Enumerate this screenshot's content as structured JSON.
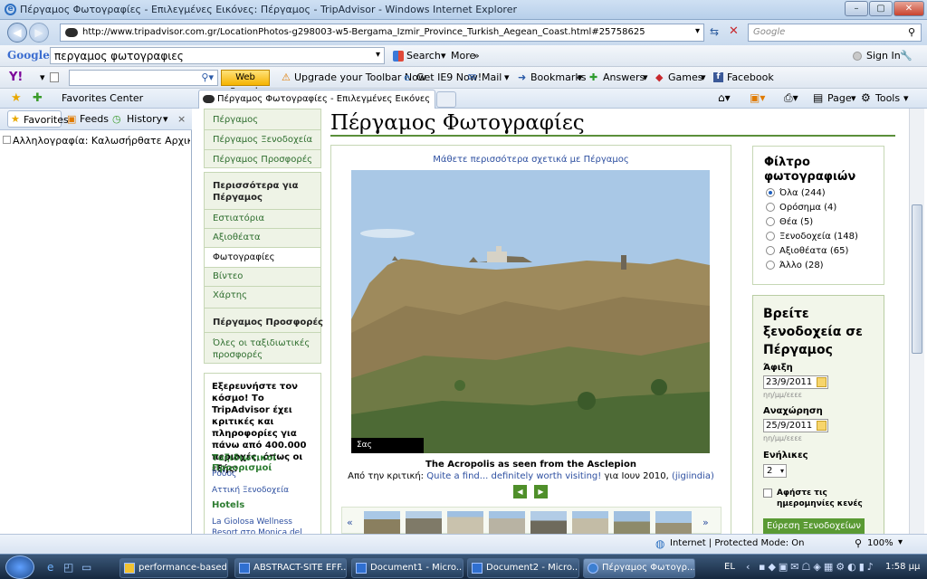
{
  "window": {
    "title": "Πέργαμος Φωτογραφίες - Επιλεγμένες Εικόνες: Πέργαμος - TripAdvisor - Windows Internet Explorer"
  },
  "address_bar": {
    "url": "http://www.tripadvisor.com.gr/LocationPhotos-g298003-w5-Bergama_Izmir_Province_Turkish_Aegean_Coast.html#25758625",
    "search_placeholder": "Google"
  },
  "google_toolbar": {
    "logo": "Google",
    "query": "περγαμος φωτογραφιες",
    "search_label": "Search",
    "more_label": "More",
    "signin_label": "Sign In"
  },
  "yahoo_toolbar": {
    "logo": "Y!",
    "web_search_label": "Web Search",
    "upgrade_label": "Upgrade your Toolbar Now",
    "ie9_label": "Get IE9 Now!",
    "mail_label": "Mail",
    "bookmarks_label": "Bookmarks",
    "answers_label": "Answers",
    "games_label": "Games",
    "facebook_label": "Facebook"
  },
  "favorites_bar": {
    "favorites_center_label": "Favorites Center",
    "tab_label": "Πέργαμος Φωτογραφίες - Επιλεγμένες Εικόνες: ...",
    "page_label": "Page",
    "tools_label": "Tools"
  },
  "favorites_panel": {
    "tabs": [
      "Favorites",
      "Feeds",
      "History"
    ],
    "close_label": "×",
    "items": [
      "Αλληλογραφία: Καλωσήρθατε Αρχική ..."
    ]
  },
  "left_nav": {
    "group1": [
      "Πέργαμος",
      "Πέργαμος Ξενοδοχεία",
      "Πέργαμος Προσφορές"
    ],
    "more_heading": "Περισσότερα για Πέργαμος",
    "group2": [
      "Εστιατόρια",
      "Αξιοθέατα",
      "Φωτογραφίες",
      "Βίντεο",
      "Χάρτης"
    ],
    "offers_heading": "Πέργαμος Προσφορές",
    "all_offers": "Όλες οι ταξιδιωτικές προσφορές",
    "explore_text": "Εξερευνήστε τον κόσμο! Το TripAdvisor έχει κριτικές και πληροφορίες για πάνω από 400.000 περιοχές, όπως οι εξής:",
    "explore_heading": "Ταξιδιωτικοί Προορισμοί",
    "explore_links": [
      "Ρόδος",
      "Αττική Ξενοδοχεία"
    ],
    "hotels_heading": "Hotels",
    "hotels_link": "La Giolosa Wellness Resort στο Monica del Garda"
  },
  "main": {
    "title": "Πέργαμος Φωτογραφίες",
    "learn_more": "Μάθετε περισσότερα σχετικά με Πέργαμος",
    "thanks_badge": "Σας ευχαριστούμε",
    "caption": "The Acropolis as seen from the Asclepion",
    "review_prefix": "Από την κριτική:",
    "review_link": "Quite a find... definitely worth visiting!",
    "review_date": "για Ιουν 2010,",
    "review_author": "(jigiindia)",
    "prev_label": "◀",
    "next_label": "▶",
    "thumb_prev": "«",
    "thumb_next": "»"
  },
  "filter": {
    "heading": "Φίλτρο φωτογραφιών",
    "options": [
      {
        "label": "Όλα (244)",
        "selected": true
      },
      {
        "label": "Ορόσημα (4)",
        "selected": false
      },
      {
        "label": "Θέα (5)",
        "selected": false
      },
      {
        "label": "Ξενοδοχεία (148)",
        "selected": false
      },
      {
        "label": "Αξιοθέατα (65)",
        "selected": false
      },
      {
        "label": "Άλλο (28)",
        "selected": false
      }
    ]
  },
  "hotel_search": {
    "heading": "Βρείτε ξενοδοχεία σε Πέργαμος",
    "checkin_label": "Άφιξη",
    "checkin_value": "23/9/2011",
    "checkout_label": "Αναχώρηση",
    "checkout_value": "25/9/2011",
    "date_hint": "ηη/μμ/εεεε",
    "adults_label": "Ενήλικες",
    "adults_value": "2",
    "leave_dates_label": "Αφήστε τις ημερομηνίες κενές",
    "submit_label": "Εύρεση Ξενοδοχείων"
  },
  "status_bar": {
    "zone": "Internet | Protected Mode: On",
    "zoom": "100%"
  },
  "taskbar": {
    "tasks": [
      "performance-based ...",
      "ABSTRACT-SITE EFF...",
      "Document1 - Micro...",
      "Document2 - Micro...",
      "Πέργαμος Φωτογρ..."
    ],
    "language": "EL",
    "clock": "1:58 μμ"
  }
}
